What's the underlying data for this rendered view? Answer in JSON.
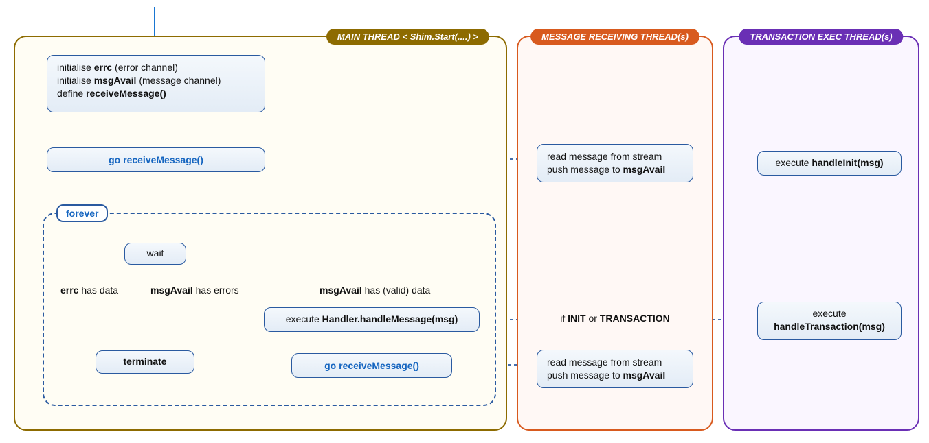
{
  "threads": {
    "main": {
      "label": "MAIN THREAD  < Shim.Start(....) >"
    },
    "recv": {
      "label": "MESSAGE RECEIVING THREAD(s)"
    },
    "exec": {
      "label": "TRANSACTION EXEC THREAD(s)"
    }
  },
  "nodes": {
    "init": {
      "l1a": "initialise ",
      "l1b": "errc",
      "l1c": " (error channel)",
      "l2a": "initialise ",
      "l2b": "msgAvail",
      "l2c": " (message channel)",
      "l3a": "define ",
      "l3b": "receiveMessage()"
    },
    "goRecv1": "go receiveMessage()",
    "forever": "forever",
    "wait": "wait",
    "cond_errc_a": "errc",
    "cond_errc_b": " has data",
    "cond_msgErr_a": "msgAvail",
    "cond_msgErr_b": " has errors",
    "cond_msgOk_a": "msgAvail",
    "cond_msgOk_b": " has (valid) data",
    "terminate": "terminate",
    "handleMsg_a": "execute ",
    "handleMsg_b": "Handler.handleMessage(msg)",
    "goRecv2": "go receiveMessage()",
    "recvBox_l1": "read message from stream",
    "recvBox_l2a": "push message to ",
    "recvBox_l2b": "msgAvail",
    "ifInit_a": "if ",
    "ifInit_b": "INIT",
    "ifInit_c": " or ",
    "ifInit_d": "TRANSACTION",
    "handleInit_a": "execute ",
    "handleInit_b": "handleInit(msg)",
    "handleTx_a": "execute",
    "handleTx_b": "handleTransaction(msg)"
  }
}
